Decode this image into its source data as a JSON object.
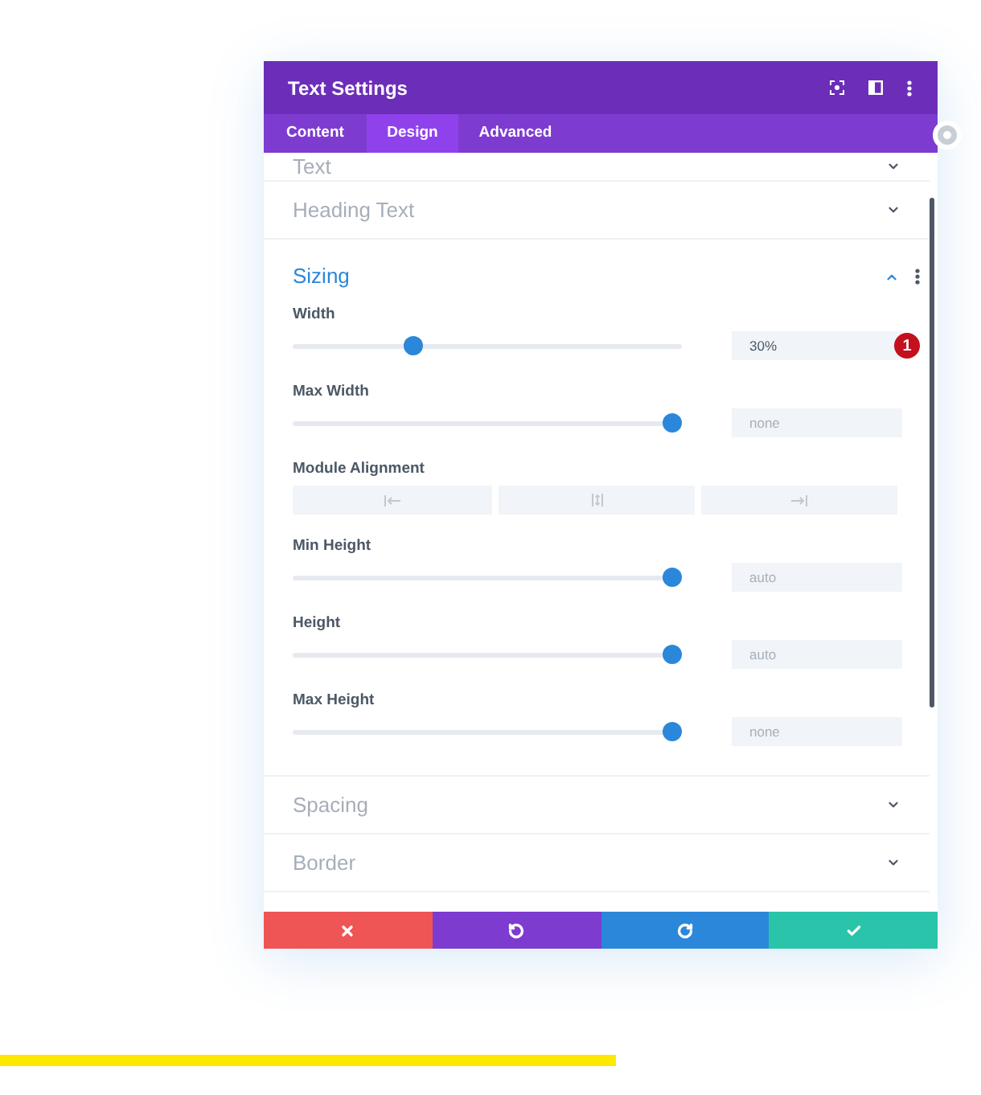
{
  "window": {
    "title": "Text Settings"
  },
  "tabs": [
    {
      "label": "Content",
      "selected": false
    },
    {
      "label": "Design",
      "selected": true
    },
    {
      "label": "Advanced",
      "selected": false
    }
  ],
  "sections": [
    {
      "title": "Text",
      "expanded": false
    },
    {
      "title": "Heading Text",
      "expanded": false
    },
    {
      "title": "Sizing",
      "expanded": true,
      "fields": [
        {
          "kind": "slider",
          "label": "Width",
          "level": 0.3,
          "value": "30%",
          "badge": "1"
        },
        {
          "kind": "slider",
          "label": "Max Width",
          "level": 1,
          "placeholder": "none"
        },
        {
          "kind": "alignment",
          "label": "Module Alignment",
          "options": [
            {
              "kind": "left",
              "selected": false
            },
            {
              "kind": "center",
              "selected": false
            },
            {
              "kind": "right",
              "selected": false
            }
          ]
        },
        {
          "kind": "slider",
          "label": "Min Height",
          "level": 1,
          "placeholder": "auto"
        },
        {
          "kind": "slider",
          "label": "Height",
          "level": 1,
          "placeholder": "auto"
        },
        {
          "kind": "slider",
          "label": "Max Height",
          "level": 1,
          "placeholder": "none"
        }
      ]
    },
    {
      "title": "Spacing",
      "expanded": false
    },
    {
      "title": "Border",
      "expanded": false
    }
  ],
  "footer_buttons": [
    {
      "kind": "discard",
      "color": "#ef5555"
    },
    {
      "kind": "undo",
      "color": "#7e3bd0"
    },
    {
      "kind": "redo",
      "color": "#2b87da"
    },
    {
      "kind": "save",
      "color": "#29c4a9"
    }
  ]
}
